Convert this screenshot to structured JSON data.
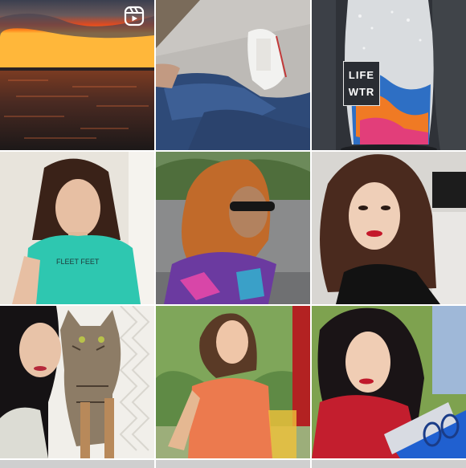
{
  "feed": {
    "layout": "grid-3-columns",
    "posts": [
      {
        "id_label": "post-1",
        "kind": "reel",
        "subject": "sunset over water",
        "badge_icon": "reels-icon"
      },
      {
        "id_label": "post-2",
        "kind": "photo",
        "subject": "jeans and white sneakers on wooden deck"
      },
      {
        "id_label": "post-3",
        "kind": "photo",
        "subject": "water bottle in car cup holder",
        "label_lines": [
          "LIFE",
          "WTR"
        ]
      },
      {
        "id_label": "post-4",
        "kind": "photo",
        "subject": "woman in teal t-shirt"
      },
      {
        "id_label": "post-5",
        "kind": "photo",
        "subject": "woman with copper hair and sunglasses"
      },
      {
        "id_label": "post-6",
        "kind": "photo",
        "subject": "woman with red lipstick portrait"
      },
      {
        "id_label": "post-7",
        "kind": "photo",
        "subject": "woman with tabby cat"
      },
      {
        "id_label": "post-8",
        "kind": "photo",
        "subject": "woman in orange t-shirt outdoors"
      },
      {
        "id_label": "post-9",
        "kind": "photo",
        "subject": "woman in red top at playground"
      }
    ]
  },
  "colors": {
    "background": "#ffffff",
    "gap": "#ffffff"
  }
}
